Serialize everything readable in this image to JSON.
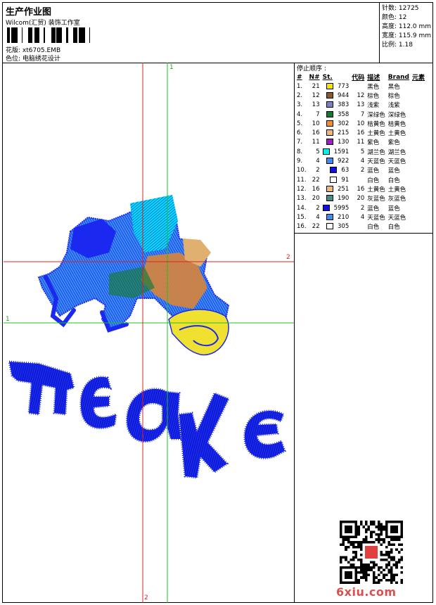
{
  "header": {
    "title": "生产作业图",
    "subtitle": "Wilcom(汇贸) 装饰工作室",
    "pattern_label": "花版: xt6705.EMB",
    "color_label": "色位: 电脑绣花设计"
  },
  "stats": {
    "stitches": "针数: 12725",
    "colors": "颜色: 12",
    "height": "高度: 112.0 mm",
    "width": "宽度: 115.9 mm",
    "ratio": "比例: 1.18"
  },
  "stop_sequence_label": "停止顺序 :",
  "table": {
    "headers": [
      "#",
      "N#",
      "St.",
      "代码",
      "描述",
      "Brand",
      "元素"
    ],
    "rows": [
      {
        "n": "1.",
        "id": "21",
        "color": "#f5e500",
        "st": "773",
        "code": "",
        "desc": "黑色",
        "brand": "黑色"
      },
      {
        "n": "2.",
        "id": "12",
        "color": "#8b5a2b",
        "st": "944",
        "code": "12",
        "desc": "棕色",
        "brand": "棕色"
      },
      {
        "n": "3.",
        "id": "13",
        "color": "#8080c0",
        "st": "383",
        "code": "13",
        "desc": "浅紫",
        "brand": "浅紫"
      },
      {
        "n": "4.",
        "id": "7",
        "color": "#107a30",
        "st": "358",
        "code": "7",
        "desc": "深绿色",
        "brand": "深绿色"
      },
      {
        "n": "5.",
        "id": "10",
        "color": "#f0902a",
        "st": "302",
        "code": "10",
        "desc": "桔黄色",
        "brand": "桔黄色"
      },
      {
        "n": "6.",
        "id": "16",
        "color": "#f0b878",
        "st": "215",
        "code": "16",
        "desc": "土黄色",
        "brand": "土黄色"
      },
      {
        "n": "7.",
        "id": "11",
        "color": "#9a20c0",
        "st": "130",
        "code": "11",
        "desc": "紫色",
        "brand": "紫色"
      },
      {
        "n": "8.",
        "id": "5",
        "color": "#00f0f0",
        "st": "1591",
        "code": "5",
        "desc": "湖兰色",
        "brand": "湖兰色"
      },
      {
        "n": "9.",
        "id": "4",
        "color": "#3a90f0",
        "st": "922",
        "code": "4",
        "desc": "天蓝色",
        "brand": "天蓝色"
      },
      {
        "n": "10.",
        "id": "2",
        "color": "#1010e0",
        "st": "63",
        "code": "2",
        "desc": "蓝色",
        "brand": "蓝色"
      },
      {
        "n": "11.",
        "id": "22",
        "color": "#ffffff",
        "st": "91",
        "code": "",
        "desc": "白色",
        "brand": "白色"
      },
      {
        "n": "12.",
        "id": "16",
        "color": "#f0b878",
        "st": "251",
        "code": "16",
        "desc": "土黄色",
        "brand": "土黄色"
      },
      {
        "n": "13.",
        "id": "20",
        "color": "#4a8a8a",
        "st": "190",
        "code": "20",
        "desc": "灰蓝色",
        "brand": "灰蓝色"
      },
      {
        "n": "14.",
        "id": "2",
        "color": "#1010e0",
        "st": "5995",
        "code": "2",
        "desc": "蓝色",
        "brand": "蓝色"
      },
      {
        "n": "15.",
        "id": "4",
        "color": "#3a90f0",
        "st": "210",
        "code": "4",
        "desc": "天蓝色",
        "brand": "天蓝色"
      },
      {
        "n": "16.",
        "id": "22",
        "color": "#ffffff",
        "st": "305",
        "code": "",
        "desc": "白色",
        "brand": "白色"
      }
    ]
  },
  "guides": {
    "v1": "1",
    "h2": "2",
    "h1": "1",
    "v2": "2"
  },
  "design_text": "πεακε",
  "watermark": "6xiu.com",
  "colors": {
    "guide_red": "#e02020",
    "guide_green": "#20c020",
    "thread_blue": "#1a28f0"
  }
}
